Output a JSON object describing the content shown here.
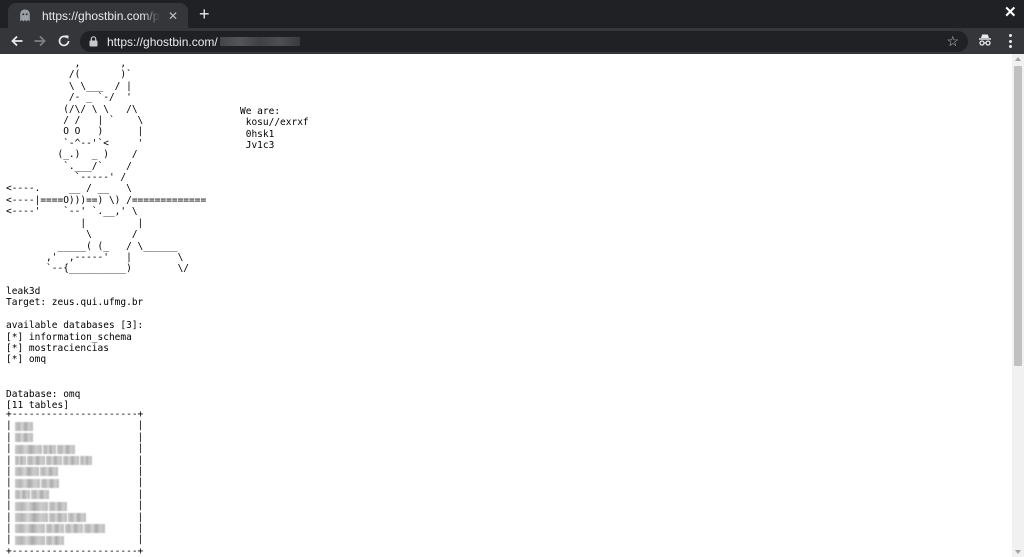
{
  "browser": {
    "tab_title": "https://ghostbin.com/paste",
    "tab_close": "✕",
    "new_tab": "+",
    "window_close": "✕",
    "url_text": "https://ghostbin.com/",
    "url_redacted": true
  },
  "page": {
    "ascii_art": "            ,       ,\n           /(       )`\n           \\ \\___  / |\n           /- _ `-/  '\n          (/\\/ \\ \\   /\\\n          / /   | `    \\\n          O O   )      |\n          `-^--'`<     '\n         (_.)  _ )    /\n          `.___/`    /\n            `-----' /\n<----.     __ / __   \\\n<----|====O)))==) \\) /=============\n<----'    `--' `.__,' \\\n             |         |\n              \\       /\n         _____( (_   / \\______\n       ,'  ,-----'   |        \\\n       `--{__________)        \\/",
    "we_are": "We are:\n kosu//exrxf\n 0hsk1\n Jv1c3",
    "info_lines": "leak3d\nTarget: zeus.qui.ufmg.br\n\navailable databases [3]:\n[*] information_schema\n[*] mostraciencias\n[*] omq\n\n\nDatabase: omq\n[11 tables]",
    "table_border_top": "+----------------------+",
    "table_row_edge": "|                      |",
    "table_border_bottom": "+----------------------+",
    "redacted_rows": [
      [
        0.3
      ],
      [
        0.3
      ],
      [
        0.45,
        0.22,
        0.3
      ],
      [
        0.18,
        0.3,
        0.26,
        0.28,
        0.2
      ],
      [
        0.4,
        0.3
      ],
      [
        0.42,
        0.3
      ],
      [
        0.25,
        0.3
      ],
      [
        0.55,
        0.3
      ],
      [
        0.55,
        0.3,
        0.3
      ],
      [
        0.5,
        0.3,
        0.3,
        0.35
      ],
      [
        0.5,
        0.3
      ]
    ]
  },
  "colors": {
    "tab_strip": "#202124",
    "toolbar": "#35363a",
    "omnibox": "#202124",
    "page_bg": "#ffffff",
    "text": "#000000",
    "scroll_thumb": "#c1c1c1"
  }
}
